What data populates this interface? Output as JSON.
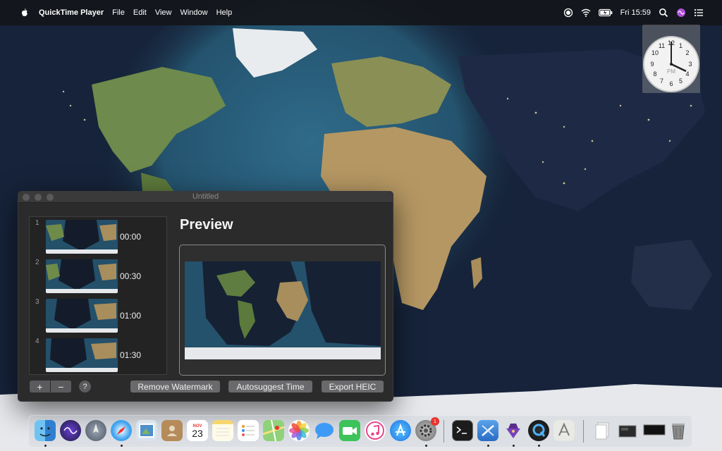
{
  "menubar": {
    "app_name": "QuickTime Player",
    "menus": [
      "File",
      "Edit",
      "View",
      "Window",
      "Help"
    ],
    "clock": "Fri 15:59",
    "icons": [
      "apple-icon",
      "record-icon",
      "wifi-icon",
      "battery-icon",
      "search-icon",
      "siri-icon",
      "control-center-icon"
    ]
  },
  "clock_widget": {
    "numbers": [
      "12",
      "1",
      "2",
      "3",
      "4",
      "5",
      "6",
      "7",
      "8",
      "9",
      "10",
      "11"
    ],
    "ampm": "PM"
  },
  "window": {
    "title": "Untitled",
    "frames": [
      {
        "index": "1",
        "time": "00:00"
      },
      {
        "index": "2",
        "time": "00:30"
      },
      {
        "index": "3",
        "time": "01:00"
      },
      {
        "index": "4",
        "time": "01:30"
      }
    ],
    "preview_heading": "Preview",
    "add_label": "+",
    "remove_label": "−",
    "help_label": "?",
    "remove_watermark_label": "Remove Watermark",
    "autosuggest_label": "Autosuggest Time",
    "export_label": "Export HEIC"
  },
  "dock": {
    "calendar": {
      "month": "NOV",
      "day": "23"
    },
    "badge_system_preferences": "1",
    "apps": [
      "finder",
      "siri",
      "launchpad",
      "safari",
      "mail-stamp",
      "contacts",
      "calendar",
      "notes",
      "reminders",
      "maps",
      "photos",
      "messages",
      "facetime",
      "itunes",
      "app-store",
      "system-preferences",
      "terminal",
      "xcode",
      "alfred",
      "quicktime",
      "script-editor",
      "document",
      "screenshot",
      "sleep-monitor",
      "trash"
    ],
    "sleep_label": "sleep"
  },
  "colors": {
    "window_bg": "#2b2b2c",
    "button_bg": "#6a6a6c",
    "ocean": "#1f4a66",
    "land": "#b19563"
  }
}
